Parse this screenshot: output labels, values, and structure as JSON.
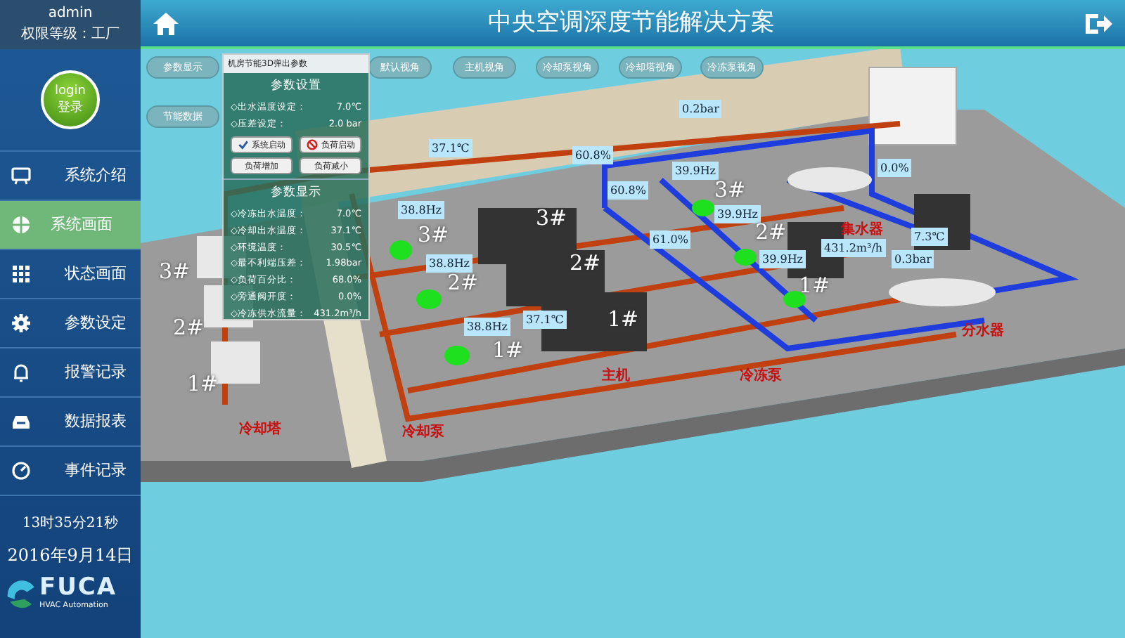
{
  "sidebar": {
    "user": "admin",
    "permission": "权限等级：工厂",
    "login": {
      "label_top": "login",
      "label_bottom": "登录"
    },
    "items": [
      {
        "label": "系统介绍",
        "selected": false
      },
      {
        "label": "系统画面",
        "selected": true
      },
      {
        "label": "状态画面",
        "selected": false
      },
      {
        "label": "参数设定",
        "selected": false
      },
      {
        "label": "报警记录",
        "selected": false
      },
      {
        "label": "数据报表",
        "selected": false
      },
      {
        "label": "事件记录",
        "selected": false
      }
    ],
    "time": "13时35分21秒",
    "date": "2016年9月14日",
    "logo": {
      "name": "FUCA",
      "subtitle": "HVAC Automation"
    }
  },
  "header": {
    "title": "中央空调深度节能解决方案"
  },
  "side_buttons": [
    "参数显示",
    "节能数据"
  ],
  "view_buttons": [
    "默认视角",
    "主机视角",
    "冷却泵视角",
    "冷却塔视角",
    "冷冻泵视角"
  ],
  "popup": {
    "title": "机房节能3D弹出参数",
    "settings_title": "参数设置",
    "settings": [
      {
        "label": "◇出水温度设定：",
        "value": "7.0℃"
      },
      {
        "label": "◇压差设定：",
        "value": "2.0 bar"
      }
    ],
    "buttons": [
      {
        "label": "系统启动",
        "kind": "check"
      },
      {
        "label": "负荷启动",
        "kind": "stop"
      },
      {
        "label": "负荷增加",
        "kind": "plain"
      },
      {
        "label": "负荷减小",
        "kind": "plain"
      }
    ],
    "display_title": "参数显示",
    "display": [
      {
        "label": "◇冷冻出水温度：",
        "value": "7.0℃"
      },
      {
        "label": "◇冷却出水温度：",
        "value": "37.1℃"
      },
      {
        "label": "◇环境温度：",
        "value": "30.5℃"
      },
      {
        "label": "◇最不利端压差：",
        "value": "1.98bar"
      },
      {
        "label": "◇负荷百分比：",
        "value": "68.0%"
      },
      {
        "label": "◇旁通阀开度：",
        "value": "0.0%"
      },
      {
        "label": "◇冷冻供水流量：",
        "value": "431.2m³/h"
      }
    ]
  },
  "plant": {
    "readings": [
      "0.2bar",
      "37.1℃",
      "60.8%",
      "60.8%",
      "61.0%",
      "39.9Hz",
      "39.9Hz",
      "39.9Hz",
      "38.8Hz",
      "38.8Hz",
      "38.8Hz",
      "37.1℃",
      "0.0%",
      "7.3℃",
      "431.2m³/h",
      "0.3bar"
    ],
    "unit_numbers": [
      "3#",
      "2#",
      "1#",
      "3#",
      "2#",
      "1#",
      "3#",
      "2#",
      "1#",
      "3#",
      "2#",
      "1#"
    ],
    "area_labels": [
      "冷却塔",
      "冷却泵",
      "主机",
      "冷冻泵",
      "集水器",
      "分水器"
    ]
  }
}
